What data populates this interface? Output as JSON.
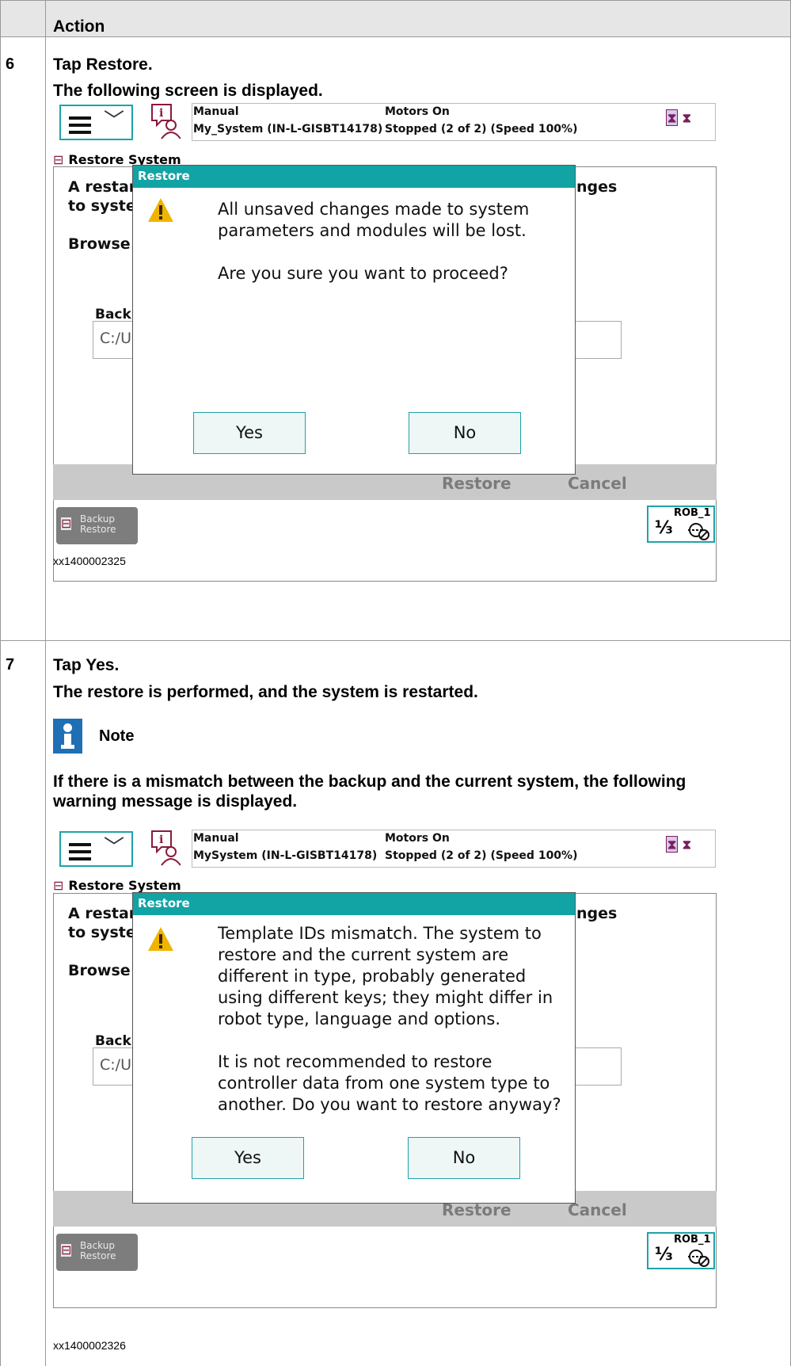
{
  "table": {
    "header": "Action",
    "step6": {
      "number": "6",
      "instruction_prefix": "Tap ",
      "instruction_bold": "Restore",
      "instruction_suffix": ".",
      "result": "The following screen is displayed.",
      "caption": "xx1400002325"
    },
    "step7": {
      "number": "7",
      "instruction_prefix": "Tap ",
      "instruction_bold": "Yes",
      "instruction_suffix": ".",
      "result": "The restore is performed, and the system is restarted.",
      "note_label": "Note",
      "note_line1": "If there is a mismatch between the backup and the current system, the following",
      "note_line2": "warning message is displayed.",
      "caption": "xx1400002326"
    }
  },
  "screen1": {
    "mode": "Manual",
    "system": "My_System (IN-L-GISBT14178)",
    "motors": "Motors On",
    "state": "Stopped (2 of 2) (Speed 100%)",
    "app_title": "Restore System",
    "bg_line1": "A restart",
    "bg_line1_end": "nges",
    "bg_line2": "to systen",
    "bg_browse": "Browse t",
    "bg_backup_label": "Backu",
    "bg_input_value": "C:/U",
    "cmd_restore": "Restore",
    "cmd_cancel": "Cancel",
    "backup_btn": [
      "Backup",
      "Restore"
    ],
    "rob": "ROB_1",
    "rob_fraction": "⅓",
    "dialog": {
      "title": "Restore",
      "messages": [
        "All unsaved changes made to system parameters and modules will be lost.",
        "Are you sure you want to proceed?"
      ],
      "yes": "Yes",
      "no": "No"
    }
  },
  "screen2": {
    "mode": "Manual",
    "system": "MySystem (IN-L-GISBT14178)",
    "motors": "Motors On",
    "state": "Stopped (2 of 2) (Speed 100%)",
    "app_title": "Restore System",
    "bg_line1": "A restart",
    "bg_line1_end": "nges",
    "bg_line2": "to systen",
    "bg_browse": "Browse t",
    "bg_backup_label": "Backu",
    "bg_input_value": "C:/U",
    "cmd_restore": "Restore",
    "cmd_cancel": "Cancel",
    "backup_btn": [
      "Backup",
      "Restore"
    ],
    "rob": "ROB_1",
    "rob_fraction": "⅓",
    "dialog": {
      "title": "Restore",
      "messages": [
        "Template IDs mismatch. The system to restore and the current system are different in type, probably generated using different keys; they might differ in robot type, language and options.",
        "It is not recommended to restore controller data from one system type to another. Do you want to restore anyway?"
      ],
      "yes": "Yes",
      "no": "No"
    }
  },
  "colors": {
    "accent": "#12a4a4",
    "warning": "#f0b400",
    "note": "#1f6fb5",
    "icon_maroon": "#8a1a3a"
  }
}
